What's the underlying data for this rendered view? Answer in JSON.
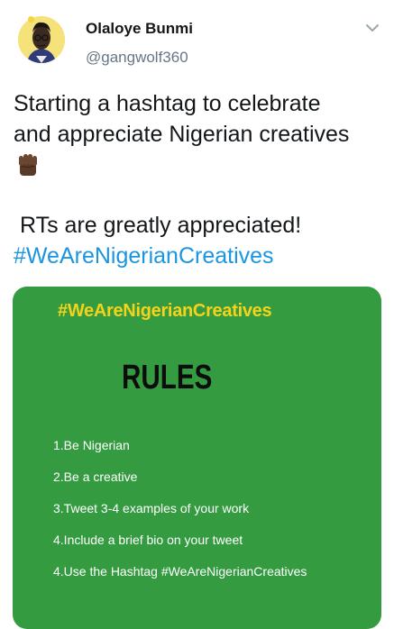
{
  "author": {
    "display_name": "Olaloye Bunmi",
    "handle": "@gangwolf360"
  },
  "tweet": {
    "text_line1": "Starting a hashtag to celebrate",
    "text_line2": "and appreciate Nigerian creatives",
    "emoji": "raised-fist-dark-skin-tone",
    "rt_line": "RTs are greatly appreciated!",
    "hashtag": "#WeAreNigerianCreatives"
  },
  "media": {
    "background_color": "#359b41",
    "hashtag_color": "#f5d31a",
    "hashtag": "#WeAreNigerianCreatives",
    "title": "RULES",
    "rules": [
      "1.Be Nigerian",
      "2.Be a creative",
      "3.Tweet 3-4 examples of your work",
      "4.Include a brief bio on your tweet",
      "4.Use the Hashtag #WeAreNigerianCreatives"
    ]
  },
  "colors": {
    "link": "#1b95e0",
    "secondary_text": "#657786"
  }
}
